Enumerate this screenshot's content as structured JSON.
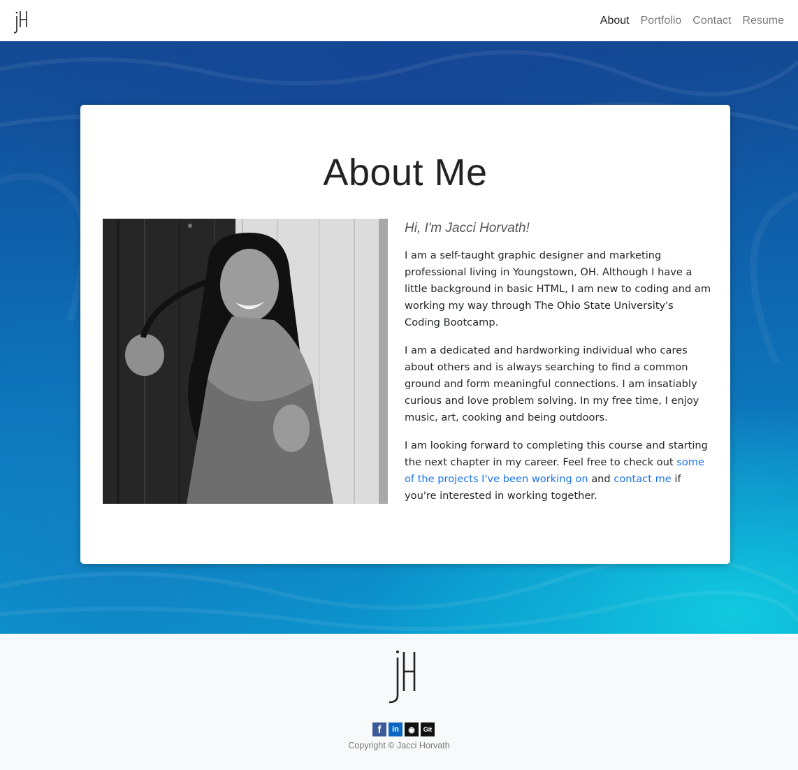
{
  "brand": {
    "logo_text": "jH"
  },
  "nav": {
    "items": [
      {
        "label": "About"
      },
      {
        "label": "Portfolio"
      },
      {
        "label": "Contact"
      },
      {
        "label": "Resume"
      }
    ]
  },
  "about": {
    "title": "About Me",
    "greeting": "Hi, I'm Jacci Horvath!",
    "paragraph1": "I am a self-taught graphic designer and marketing professional living in Youngstown, OH. Although I have a little background in basic HTML, I am new to coding and am working my way through The Ohio State University's Coding Bootcamp.",
    "paragraph2": "I am a dedicated and hardworking individual who cares about others and is always searching to find a common ground and form meaningful connections. I am insatiably curious and love problem solving. In my free time, I enjoy music, art, cooking and being outdoors.",
    "paragraph3": {
      "part1": "I am looking forward to completing this course and starting the next chapter in my career. Feel free to check out ",
      "link1": "some of the projects I've been working on",
      "part2": " and ",
      "link2": "contact me",
      "part3": " if you're interested in working together."
    }
  },
  "footer": {
    "social": [
      {
        "icon": "facebook-icon",
        "glyph": "f"
      },
      {
        "icon": "linkedin-icon",
        "glyph": "in"
      },
      {
        "icon": "github-icon",
        "glyph": "◉"
      },
      {
        "icon": "git-icon",
        "glyph": "Git"
      }
    ],
    "copyright": "Copyright © Jacci Horvath"
  },
  "colors": {
    "link": "#1a73e8",
    "facebook": "#3b5998",
    "linkedin": "#0a66c2"
  }
}
